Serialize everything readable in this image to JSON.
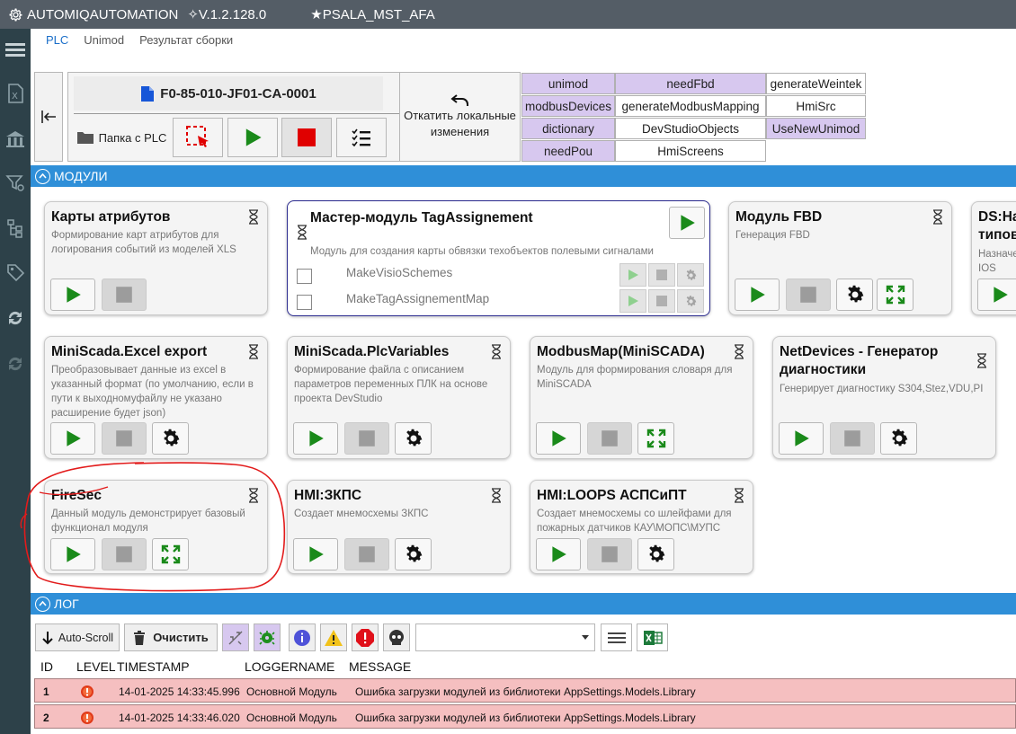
{
  "app": {
    "name": "AUTOMIQAUTOMATION",
    "version": "✧V.1.2.128.0",
    "project_tag": "★PSALA_MST_AFA"
  },
  "nav_tabs": [
    "PLC",
    "Unimod",
    "Результат сборки"
  ],
  "sidebar_icons": [
    "menu-icon",
    "excel-file-icon",
    "building-icon",
    "filter-icon",
    "tree-icon",
    "tag-icon",
    "sync-icon",
    "sync-disabled-icon"
  ],
  "toolbar": {
    "project_name": "F0-85-010-JF01-CA-0001",
    "plc_folder": "Папка с PLC",
    "rollback_line1": "Откатить локальные",
    "rollback_line2": "изменения"
  },
  "flags": [
    {
      "label": "unimod",
      "on": true
    },
    {
      "label": "needFbd",
      "on": true
    },
    {
      "label": "generateWeintek",
      "on": false
    },
    {
      "label": "modbusDevices",
      "on": true
    },
    {
      "label": "generateModbusMapping",
      "on": false
    },
    {
      "label": "HmiSrc",
      "on": false
    },
    {
      "label": "dictionary",
      "on": true
    },
    {
      "label": "DevStudioObjects",
      "on": false
    },
    {
      "label": "UseNewUnimod",
      "on": true
    },
    {
      "label": "needPou",
      "on": true
    },
    {
      "label": "HmiScreens",
      "on": false
    }
  ],
  "sections": {
    "modules": "МОДУЛИ",
    "log": "ЛОГ"
  },
  "modules": [
    {
      "title": "Карты атрибутов",
      "desc": "Формирование карт атрибутов для логирования событий из моделей XLS"
    },
    {
      "title": "Мастер-модуль TagAssignement",
      "desc": "Модуль для создания карты обвязки техобъектов полевыми сигналами",
      "subitems": [
        "MakeVisioSchemes",
        "MakeTagAssignementMap"
      ]
    },
    {
      "title": "Модуль FBD",
      "desc": "Генерация FBD"
    },
    {
      "title": "DS:На типов",
      "desc": "Назначе IOS"
    },
    {
      "title": "MiniScada.Excel export",
      "desc": "Преобразовывает данные из excel в указанный формат (по умолчанию, если в пути к выходномуфайлу не указано расширение будет json)"
    },
    {
      "title": "MiniScada.PlcVariables",
      "desc": "Формирование файла с описанием параметров переменных ПЛК на основе проекта DevStudio"
    },
    {
      "title": "ModbusMap(MiniSCADA)",
      "desc": "Модуль для формирования словаря для MiniSCADA"
    },
    {
      "title": "NetDevices - Генератор диагностики",
      "desc": "Генерирует диагностику S304,Stez,VDU,PI"
    },
    {
      "title": "FireSec",
      "desc": "Данный модуль демонстрирует базовый функционал модуля"
    },
    {
      "title": "HMI:ЗКПС",
      "desc": "Создает мнемосхемы ЗКПС"
    },
    {
      "title": "HMI:LOOPS АСПСиПТ",
      "desc": "Создает мнемосхемы со шлейфами для пожарных датчиков КАУ\\МОПС\\МУПС"
    }
  ],
  "log_toolbar": {
    "autoscroll": "Auto-Scroll",
    "clear": "Очистить",
    "level_select": ""
  },
  "log_columns": [
    "ID",
    "LEVEL",
    "TIMESTAMP",
    "LOGGERNAME",
    "MESSAGE"
  ],
  "log_rows": [
    {
      "id": "1",
      "timestamp": "14-01-2025 14:33:45.996",
      "logger": "Основной Модуль",
      "message": "Ошибка загрузки модулей из библиотеки AppSettings.Models.Library"
    },
    {
      "id": "2",
      "timestamp": "14-01-2025 14:33:46.020",
      "logger": "Основной Модуль",
      "message": "Ошибка загрузки модулей из библиотеки AppSettings.Models.Library"
    }
  ],
  "colors": {
    "accent": "#2f8fd8",
    "sidebar": "#2d4149",
    "titlebar": "#545d66",
    "flag_on": "#d7c8ef",
    "error_row": "#f5bfc0",
    "play_green": "#1a8a1a",
    "stop_red": "#e00000"
  }
}
